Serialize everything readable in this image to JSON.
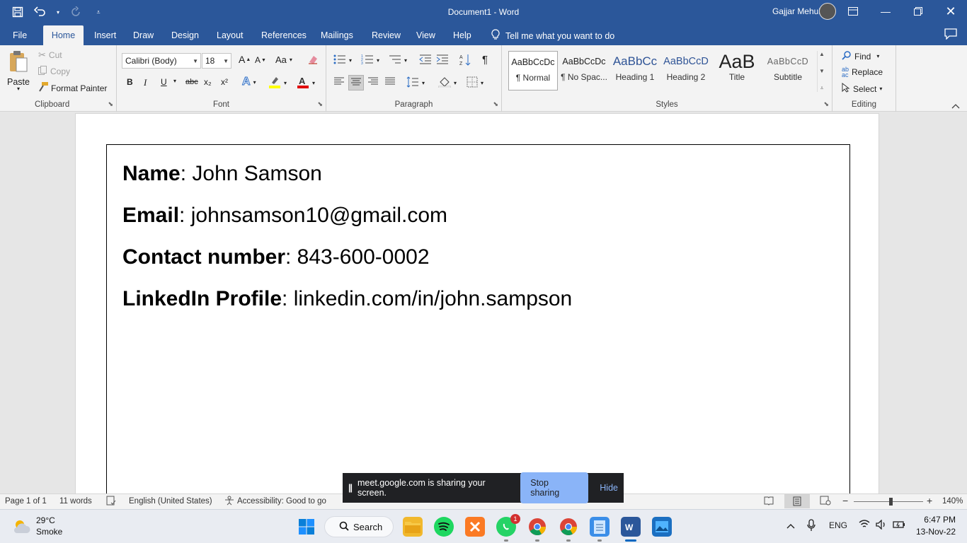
{
  "titlebar": {
    "title": "Document1  -  Word",
    "user_name": "Gajjar Mehul",
    "undo_icon": "undo-icon",
    "redo_icon": "redo-icon"
  },
  "tabs": [
    "File",
    "Home",
    "Insert",
    "Draw",
    "Design",
    "Layout",
    "References",
    "Mailings",
    "Review",
    "View",
    "Help"
  ],
  "active_tab": "Home",
  "tell_me": "Tell me what you want to do",
  "clipboard": {
    "paste": "Paste",
    "cut": "Cut",
    "copy": "Copy",
    "format_painter": "Format Painter",
    "label": "Clipboard"
  },
  "font": {
    "name": "Calibri (Body)",
    "size": "18",
    "label": "Font",
    "bold": "B",
    "italic": "I",
    "underline": "U",
    "strike": "abc",
    "subscript": "x₂",
    "superscript": "x²",
    "grow": "A",
    "shrink": "A",
    "case": "Aa"
  },
  "paragraph": {
    "label": "Paragraph"
  },
  "styles": {
    "label": "Styles",
    "items": [
      {
        "preview": "AaBbCcDc",
        "name": "¶ Normal"
      },
      {
        "preview": "AaBbCcDc",
        "name": "¶ No Spac..."
      },
      {
        "preview": "AaBbCc",
        "name": "Heading 1"
      },
      {
        "preview": "AaBbCcD",
        "name": "Heading 2"
      },
      {
        "preview": "AaB",
        "name": "Title"
      },
      {
        "preview": "AaBbCcD",
        "name": "Subtitle"
      }
    ]
  },
  "editing": {
    "label": "Editing",
    "find": "Find",
    "replace": "Replace",
    "select": "Select"
  },
  "document": {
    "lines": [
      {
        "label": "Name",
        "value": ": John Samson"
      },
      {
        "label": "Email",
        "value": ": johnsamson10@gmail.com"
      },
      {
        "label": "Contact number",
        "value": ": 843-600-0002"
      },
      {
        "label": "LinkedIn Profile",
        "value": ": linkedin.com/in/john.sampson"
      }
    ]
  },
  "share_bar": {
    "message": "meet.google.com is sharing your screen.",
    "stop": "Stop sharing",
    "hide": "Hide"
  },
  "status": {
    "page": "Page 1 of 1",
    "words": "11 words",
    "language": "English (United States)",
    "accessibility": "Accessibility: Good to go",
    "zoom": "140%"
  },
  "taskbar": {
    "weather_temp": "29°C",
    "weather_cond": "Smoke",
    "search": "Search",
    "whatsapp_badge": "1",
    "lang": "ENG",
    "time": "6:47 PM",
    "date": "13-Nov-22"
  },
  "colors": {
    "word_blue": "#2b579a",
    "share_button": "#8ab4f8"
  }
}
